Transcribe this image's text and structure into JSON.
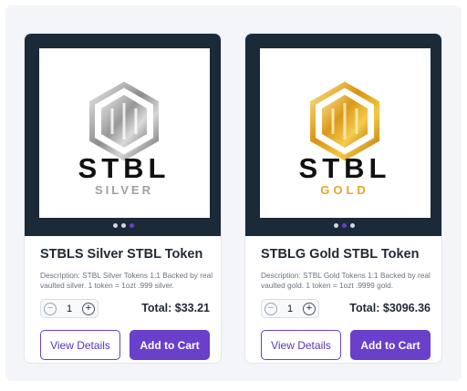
{
  "products": [
    {
      "title": "STBLS Silver STBL Token",
      "description": "Description: STBL Silver Tokens 1:1 Backed by real vaulted silver. 1 token = 1ozt .999 silver.",
      "quantity": "1",
      "total": "Total: $33.21",
      "view_label": "View Details",
      "cart_label": "Add to Cart",
      "logo_word": "STBL",
      "logo_sub": "SILVER",
      "metal_color": "#9a9a9a",
      "active_slide": 3
    },
    {
      "title": "STBLG Gold STBL Token",
      "description": "Description: STBL Gold Tokens 1:1 Backed by real vaulted gold. 1 token = 1ozt .9999 gold.",
      "quantity": "1",
      "total": "Total: $3096.36",
      "view_label": "View Details",
      "cart_label": "Add to Cart",
      "logo_word": "STBL",
      "logo_sub": "GOLD",
      "metal_color": "#e0a419",
      "active_slide": 2
    }
  ],
  "stepper": {
    "minus": "−",
    "plus": "+"
  },
  "colors": {
    "accent": "#6a3fc9",
    "media_bg": "#1b2a38"
  }
}
